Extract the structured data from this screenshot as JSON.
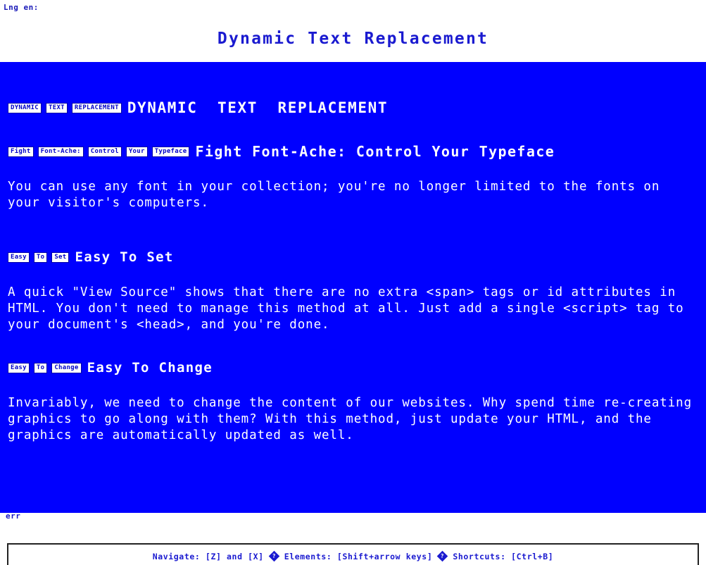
{
  "browser": {
    "top_status": "Lng en:",
    "bottom_status_fragment": "err"
  },
  "document": {
    "title": "Dynamic Text Replacement"
  },
  "page": {
    "background_color": "#0000ff",
    "text_color": "#ffffff",
    "link_color": "#1a1ad0",
    "sections": [
      {
        "id": "h1",
        "alt_boxes": [
          "DYNAMIC",
          "TEXT",
          "REPLACEMENT"
        ],
        "heading": "DYNAMIC  TEXT  REPLACEMENT"
      },
      {
        "id": "h2",
        "alt_boxes": [
          "Fight",
          "Font-Ache:",
          "Control",
          "Your",
          "Typeface"
        ],
        "heading": "Fight Font-Ache: Control Your Typeface",
        "body": "You can use any font in your collection; you're no longer limited to the fonts on your visitor's computers."
      },
      {
        "id": "h3",
        "alt_boxes": [
          "Easy",
          "To",
          "Set"
        ],
        "heading": "Easy To Set",
        "body": "A quick \"View Source\" shows that there are no extra <span> tags or id attributes in HTML. You don't need to manage this method at all. Just add a single <script> tag to your document's <head>, and you're done."
      },
      {
        "id": "h4",
        "alt_boxes": [
          "Easy",
          "To",
          "Change"
        ],
        "heading": "Easy To Change",
        "body": "Invariably, we need to change the content of our websites. Why spend time re-creating graphics to go along with them? With this method, just update your HTML, and the graphics are automatically updated as well."
      }
    ]
  },
  "hint_bar": {
    "segments": [
      "Navigate: [Z] and [X]",
      "Elements: [Shift+arrow keys]",
      "Shortcuts: [Ctrl+B]"
    ],
    "separator_icon": "diamond-question-icon"
  }
}
